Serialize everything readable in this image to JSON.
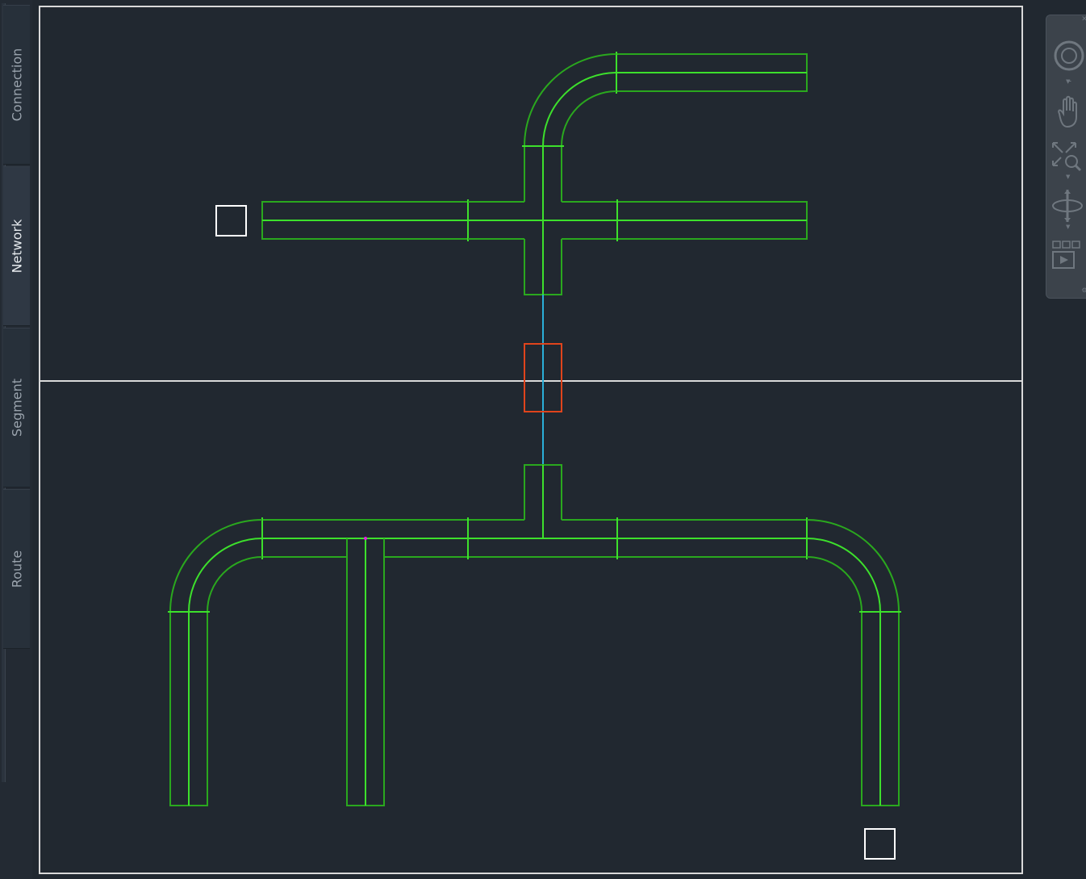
{
  "side_tabs": [
    {
      "label": "Connection",
      "active": false
    },
    {
      "label": "Network",
      "active": true
    },
    {
      "label": "Segment",
      "active": false
    },
    {
      "label": "Route",
      "active": false
    }
  ],
  "navigation_bar": {
    "tools": [
      "steering-wheel-icon",
      "pan-hand-icon",
      "zoom-extents-icon",
      "orbit-icon",
      "showmotion-icon"
    ]
  },
  "colors": {
    "background": "#212830",
    "pipe_outline": "#2aa81e",
    "pipe_centerline": "#3de02c",
    "connector": "#2bb0d8",
    "selection": "#e0441c",
    "viewport_border": "#d9d9d9",
    "marker": "#ffffff",
    "magenta_point": "#e020e0"
  }
}
